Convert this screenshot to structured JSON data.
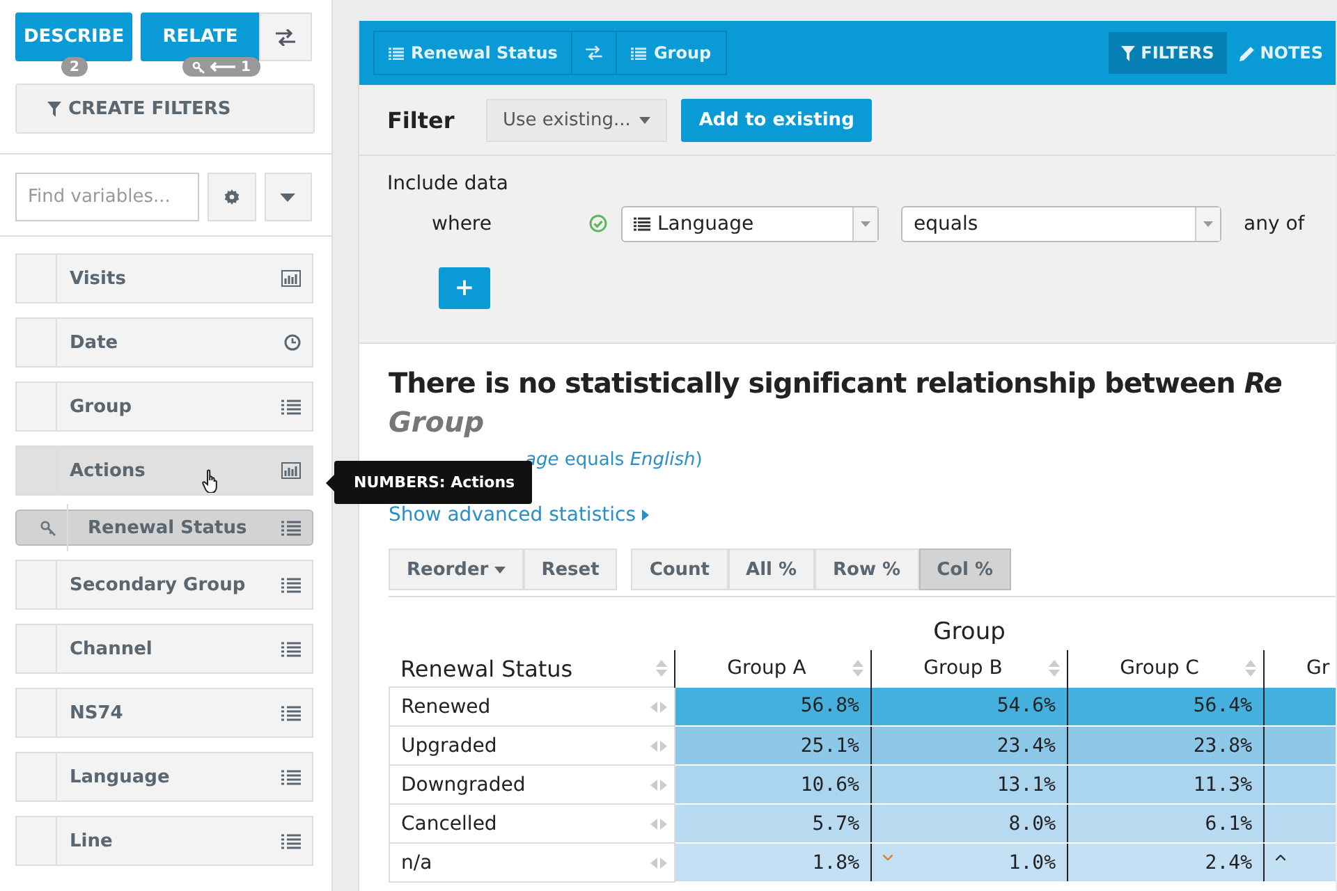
{
  "sidebar": {
    "buttons": [
      {
        "label": "DESCRIBE",
        "badge": "2",
        "kind": "count"
      },
      {
        "label": "RELATE",
        "badge": "1",
        "kind": "key"
      }
    ],
    "create_filters": "CREATE FILTERS",
    "search": {
      "placeholder": "Find variables..."
    },
    "variables": [
      {
        "name": "Visits",
        "kind": "numeric",
        "hovered": false,
        "selected": false
      },
      {
        "name": "Date",
        "kind": "datetime",
        "hovered": false,
        "selected": false
      },
      {
        "name": "Group",
        "kind": "categorical",
        "hovered": false,
        "selected": false
      },
      {
        "name": "Actions",
        "kind": "numeric",
        "hovered": true,
        "selected": false
      },
      {
        "name": "Renewal Status",
        "kind": "categorical",
        "hovered": false,
        "selected": true
      },
      {
        "name": "Secondary Group",
        "kind": "categorical",
        "hovered": false,
        "selected": false
      },
      {
        "name": "Channel",
        "kind": "categorical",
        "hovered": false,
        "selected": false
      },
      {
        "name": "NS74",
        "kind": "categorical",
        "hovered": false,
        "selected": false
      },
      {
        "name": "Language",
        "kind": "categorical",
        "hovered": false,
        "selected": false
      },
      {
        "name": "Line",
        "kind": "categorical",
        "hovered": false,
        "selected": false
      }
    ]
  },
  "tooltip": "NUMBERS: Actions",
  "header": {
    "row_variable": "Renewal Status",
    "column_variable": "Group",
    "tabs": [
      {
        "label": "FILTERS",
        "kind": "filter",
        "selected": true
      },
      {
        "label": "NOTES",
        "kind": "notes",
        "selected": false
      }
    ]
  },
  "filter": {
    "title": "Filter",
    "use_existing": "Use existing...",
    "add_button": "Add to existing",
    "include_label": "Include data",
    "where_label": "where",
    "valid": true,
    "variable": "Language",
    "operator": "equals",
    "operand_label": "any of",
    "add_condition": "+"
  },
  "result": {
    "headline": "There is no statistically significant relationship between *Re*",
    "headline_line2": "Group",
    "condition": "*age* equals *English*)",
    "advanced_link": "Show advanced statistics",
    "arrange_buttons": [
      {
        "label": "Reorder",
        "kind": "dropdown"
      },
      {
        "label": "Reset",
        "kind": "plain"
      }
    ],
    "measures": [
      {
        "label": "Count",
        "selected": false
      },
      {
        "label": "All %",
        "selected": false
      },
      {
        "label": "Row %",
        "selected": false
      },
      {
        "label": "Col %",
        "selected": true
      }
    ]
  },
  "table": {
    "column_group": "Group",
    "row_header": "Renewal Status",
    "columns": [
      "Group A",
      "Group B",
      "Group C",
      "Gr"
    ],
    "rows": [
      {
        "label": "Renewed",
        "color": "#45b0de",
        "cells": [
          {
            "value": "56.8%"
          },
          {
            "value": "54.6%"
          },
          {
            "value": "56.4%"
          },
          {}
        ]
      },
      {
        "label": "Upgraded",
        "color": "#8ec8e8",
        "cells": [
          {
            "value": "25.1%"
          },
          {
            "value": "23.4%"
          },
          {
            "value": "23.8%"
          },
          {}
        ]
      },
      {
        "label": "Downgraded",
        "color": "#abd4ee",
        "cells": [
          {
            "value": "10.6%"
          },
          {
            "value": "13.1%"
          },
          {
            "value": "11.3%"
          },
          {}
        ]
      },
      {
        "label": "Cancelled",
        "color": "#b7daf1",
        "cells": [
          {
            "value": "5.7%"
          },
          {
            "value": "8.0%"
          },
          {
            "value": "6.1%"
          },
          {}
        ]
      },
      {
        "label": "n/a",
        "color": "#c3e0f4",
        "cells": [
          {
            "value": "1.8%"
          },
          {
            "value": "1.0%",
            "kind": "low"
          },
          {
            "value": "2.4%"
          },
          {
            "kind": "high"
          }
        ]
      }
    ]
  }
}
